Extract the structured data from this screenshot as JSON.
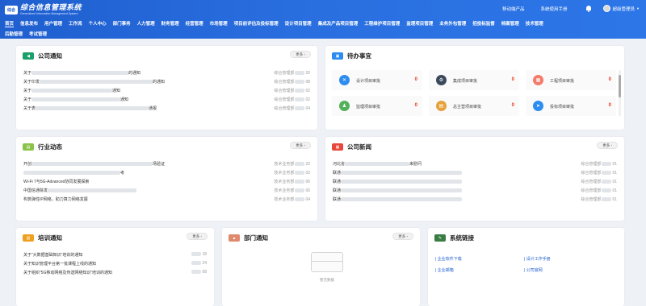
{
  "header": {
    "logo_badge": "综合",
    "title": "综合信息管理系统",
    "subtitle": "Generalized Information Management System",
    "links": [
      "移动端产品",
      "系统使用手册"
    ],
    "user_name": "超级管理员"
  },
  "nav": {
    "row1": [
      "首页",
      "信息发布",
      "用户管理",
      "工作流",
      "个人中心",
      "部门事务",
      "人力管理",
      "财务管理",
      "经营管理",
      "市场管理",
      "项目前评估及投标管理",
      "设计项目管理",
      "集成及产品项目管理",
      "工程维护项目管理",
      "监理项目管理",
      "业务外包管理",
      "招投标监督",
      "档案管理",
      "技术管理"
    ],
    "row2": [
      "后勤管理",
      "考试管理"
    ]
  },
  "company_notice": {
    "title": "公司通知",
    "more": "更多 ›",
    "rows": [
      {
        "prefix": "关于",
        "suffix": "的通知",
        "dept": "综合管理部",
        "date": "20"
      },
      {
        "prefix": "关于印发",
        "suffix": "的通知",
        "dept": "综合管理部",
        "date": "08"
      },
      {
        "prefix": "关于",
        "suffix": "通知",
        "dept": "综合管理部",
        "date": "02"
      },
      {
        "prefix": "关于",
        "suffix": "通知",
        "dept": "综合管理部",
        "date": "02"
      },
      {
        "prefix": "关于表",
        "suffix": "通报",
        "dept": "综合管理部",
        "date": "04"
      }
    ]
  },
  "todo": {
    "title": "待办事宜",
    "items": [
      {
        "label": "设计项目审批",
        "count": "0",
        "color": "#2d8cf0",
        "glyph": "✕"
      },
      {
        "label": "集成项目审批",
        "count": "0",
        "color": "#3a4a5c",
        "glyph": "⚙"
      },
      {
        "label": "工程项目审批",
        "count": "0",
        "color": "#f47a6b",
        "glyph": "▦"
      },
      {
        "label": "监理项目审批",
        "count": "0",
        "color": "#52b15a",
        "glyph": "♟"
      },
      {
        "label": "总主营项目审批",
        "count": "0",
        "color": "#e6a23c",
        "glyph": "▤"
      },
      {
        "label": "投标项目审批",
        "count": "0",
        "color": "#2d8cf0",
        "glyph": "➤"
      }
    ]
  },
  "industry": {
    "title": "行业动态",
    "more": "更多 ›",
    "rows": [
      {
        "prefix": "开创",
        "suffix": "场验证",
        "dept": "技术业务部",
        "date": "22"
      },
      {
        "prefix": "",
        "suffix": "考",
        "dept": "技术业务部",
        "date": "02"
      },
      {
        "prefix": "Wi-Fi 7与5G-Advanced协同发展探索",
        "suffix": "",
        "dept": "技术业务部",
        "date": "06"
      },
      {
        "prefix": "中国信通院发",
        "suffix": "",
        "dept": "技术业务部",
        "date": "06"
      },
      {
        "prefix": "构筑弹性IP网络，助力算力网络发展",
        "suffix": "",
        "dept": "技术业务部",
        "date": "04"
      }
    ]
  },
  "company_news": {
    "title": "公司新闻",
    "more": "更多 ›",
    "rows": [
      {
        "prefix": "河北省",
        "suffix": "来慰问",
        "dept": "综合管理部",
        "date": "01"
      },
      {
        "prefix": "联通",
        "suffix": "",
        "dept": "综合管理部",
        "date": "01"
      },
      {
        "prefix": "联通",
        "suffix": "",
        "dept": "综合管理部",
        "date": "01"
      },
      {
        "prefix": "联通",
        "suffix": "",
        "dept": "综合管理部",
        "date": "01"
      },
      {
        "prefix": "联通",
        "suffix": "",
        "dept": "综合管理部",
        "date": "01"
      }
    ]
  },
  "training": {
    "title": "培训通知",
    "more": "更多 ›",
    "rows": [
      {
        "text": "关于“大数据基础知识”培训的通知",
        "date": "18"
      },
      {
        "text": "关于知识管理平台第一批课程上线的通知",
        "date": "24"
      },
      {
        "text": "关于组织“5G移动网络及传送网络知识”培训的通知",
        "date": "08"
      }
    ]
  },
  "department": {
    "title": "部门通知",
    "more": "更多 ›",
    "empty": "暂无数据"
  },
  "syslinks": {
    "title": "系统链接",
    "items": [
      "企业软件下载",
      "设计工作手册",
      "企业邮箱",
      "公司官网"
    ]
  }
}
